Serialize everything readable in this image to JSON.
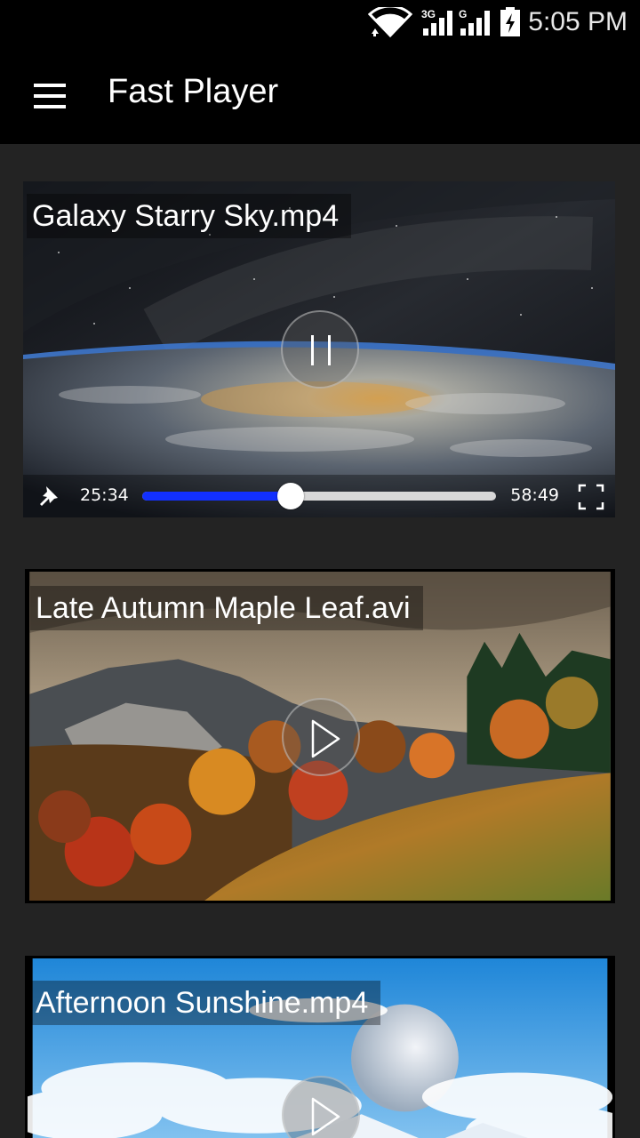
{
  "status_bar": {
    "time": "5:05 PM",
    "network_label_1": "3G",
    "network_label_2": "G",
    "icons": [
      "wifi-icon",
      "signal-3g-icon",
      "signal-g-icon",
      "battery-charging-icon"
    ]
  },
  "app_bar": {
    "title": "Fast Player",
    "menu_icon": "hamburger-menu-icon"
  },
  "videos": [
    {
      "title": "Galaxy Starry Sky.mp4",
      "state": "playing",
      "current_time": "25:34",
      "total_time": "58:49",
      "progress": 0.42,
      "button_icon": "pause-icon"
    },
    {
      "title": "Late Autumn Maple Leaf.avi",
      "state": "paused",
      "button_icon": "play-icon"
    },
    {
      "title": "Afternoon Sunshine.mp4",
      "state": "paused",
      "button_icon": "play-icon"
    }
  ],
  "colors": {
    "background": "#232323",
    "app_bar": "#000000",
    "progress_fill": "#1230ff",
    "progress_track": "#d8d8d8"
  }
}
